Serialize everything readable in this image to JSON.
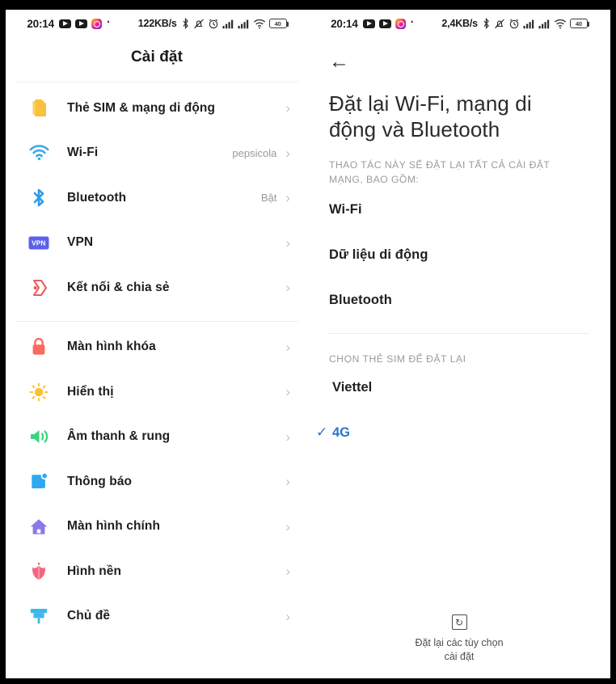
{
  "status_bar": {
    "left_screen": {
      "time": "20:14",
      "app_icons": [
        "youtube-icon",
        "youtube-icon",
        "instagram-icon"
      ],
      "separator": "·",
      "network_speed": "122KB/s",
      "icons": [
        "bluetooth-icon",
        "silent-mode-icon",
        "alarm-icon",
        "signal-icon",
        "signal-icon",
        "wifi-icon"
      ],
      "battery_level": "40"
    },
    "right_screen": {
      "time": "20:14",
      "app_icons": [
        "youtube-icon",
        "youtube-icon",
        "instagram-icon"
      ],
      "separator": "·",
      "network_speed": "2,4KB/s",
      "icons": [
        "bluetooth-icon",
        "silent-mode-icon",
        "alarm-icon",
        "signal-icon",
        "signal-icon",
        "wifi-icon"
      ],
      "battery_level": "40"
    }
  },
  "left_screen": {
    "title": "Cài đặt",
    "groups": [
      {
        "items": [
          {
            "icon": "sim-card-icon",
            "icon_color": "#f9c13c",
            "label": "Thẻ SIM & mạng di động",
            "value": ""
          },
          {
            "icon": "wifi-icon",
            "icon_color": "#3aa7e8",
            "label": "Wi-Fi",
            "value": "pepsicola"
          },
          {
            "icon": "bluetooth-icon",
            "icon_color": "#2e9ce8",
            "label": "Bluetooth",
            "value": "Bật"
          },
          {
            "icon": "vpn-icon",
            "icon_color": "#5b61ea",
            "label": "VPN",
            "value": ""
          },
          {
            "icon": "share-icon",
            "icon_color": "#f05b5b",
            "label": "Kết nối & chia sẻ",
            "value": ""
          }
        ]
      },
      {
        "items": [
          {
            "icon": "lock-icon",
            "icon_color": "#fa6b5c",
            "label": "Màn hình khóa",
            "value": ""
          },
          {
            "icon": "brightness-icon",
            "icon_color": "#fcc133",
            "label": "Hiển thị",
            "value": ""
          },
          {
            "icon": "speaker-icon",
            "icon_color": "#3ad47f",
            "label": "Âm thanh & rung",
            "value": ""
          },
          {
            "icon": "notification-icon",
            "icon_color": "#2fa8f2",
            "label": "Thông báo",
            "value": ""
          },
          {
            "icon": "home-icon",
            "icon_color": "#8b79e8",
            "label": "Màn hình chính",
            "value": ""
          },
          {
            "icon": "wallpaper-icon",
            "icon_color": "#f4667f",
            "label": "Hình nền",
            "value": ""
          },
          {
            "icon": "theme-icon",
            "icon_color": "#3fb8e8",
            "label": "Chủ đề",
            "value": ""
          }
        ]
      }
    ],
    "chevron": "›"
  },
  "right_screen": {
    "back_icon": "back-arrow-icon",
    "back_glyph": "←",
    "title": "Đặt lại Wi-Fi, mạng di động và Bluetooth",
    "caption": "THAO TÁC NÀY SẼ ĐẶT LẠI TẤT CẢ CÀI ĐẶT MẠNG, BAO GỒM:",
    "reset_items": [
      "Wi-Fi",
      "Dữ liệu di động",
      "Bluetooth"
    ],
    "sim_caption": "CHỌN THẺ SIM ĐỂ ĐẶT LẠI",
    "sim_options": [
      {
        "label": "Viettel",
        "selected": false
      },
      {
        "label": "4G",
        "selected": true
      }
    ],
    "check_glyph": "✓",
    "accent_color": "#2878c8",
    "bottom_button": {
      "icon": "reset-icon",
      "icon_glyph": "↻",
      "label_line1": "Đặt lại các tùy chọn",
      "label_line2": "cài đặt"
    }
  }
}
